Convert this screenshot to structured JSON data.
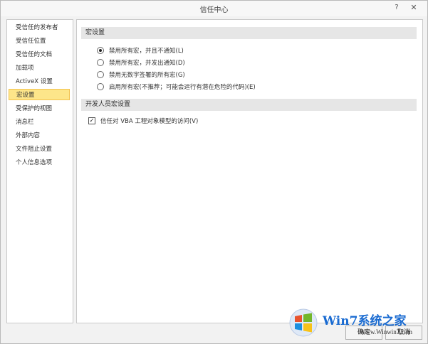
{
  "window": {
    "title": "信任中心",
    "help_label": "?",
    "close_label": "✕"
  },
  "sidebar": {
    "items": [
      {
        "label": "受信任的发布者",
        "active": false
      },
      {
        "label": "受信任位置",
        "active": false
      },
      {
        "label": "受信任的文档",
        "active": false
      },
      {
        "label": "加载项",
        "active": false
      },
      {
        "label": "ActiveX 设置",
        "active": false
      },
      {
        "label": "宏设置",
        "active": true
      },
      {
        "label": "受保护的视图",
        "active": false
      },
      {
        "label": "消息栏",
        "active": false
      },
      {
        "label": "外部内容",
        "active": false
      },
      {
        "label": "文件阻止设置",
        "active": false
      },
      {
        "label": "个人信息选项",
        "active": false
      }
    ]
  },
  "macro_settings": {
    "header": "宏设置",
    "options": [
      {
        "label": "禁用所有宏，并且不通知(L)",
        "checked": true
      },
      {
        "label": "禁用所有宏，并发出通知(D)",
        "checked": false
      },
      {
        "label": "禁用无数字签署的所有宏(G)",
        "checked": false
      },
      {
        "label": "启用所有宏(不推荐；可能会运行有潜在危险的代码)(E)",
        "checked": false
      }
    ]
  },
  "developer_settings": {
    "header": "开发人员宏设置",
    "trust_vba_label": "信任对 VBA 工程对象模型的访问(V)",
    "trust_vba_checked": true,
    "check_mark": "✓"
  },
  "footer": {
    "ok_label": "确定",
    "cancel_label": "取消"
  },
  "watermark": {
    "title": "Win7系统之家",
    "url": "Www.Winwin7.com"
  }
}
